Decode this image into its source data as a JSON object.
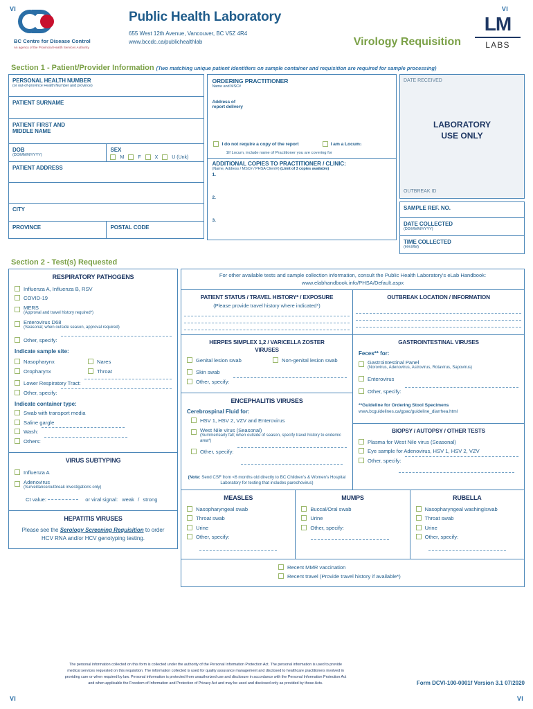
{
  "corner_marks": {
    "top_left": "VI",
    "top_right": "VI",
    "bottom_left": "VI",
    "bottom_right": "VI"
  },
  "header": {
    "cdc_name": "BC Centre for Disease Control",
    "cdc_tagline": "An agency of the Provincial Health Services Authority",
    "lab_title": "Public Health Laboratory",
    "address": "655 West 12th Avenue, Vancouver, BC V5Z 4R4",
    "website": "www.bccdc.ca/publichealthlab",
    "requisition_title": "Virology Requisition",
    "lm_logo_main": "LM",
    "lm_logo_sub": "LABS"
  },
  "section1": {
    "heading": "Section 1 - Patient/Provider Information",
    "heading_note": "(Two matching unique patient identifiers on sample container and requisition are required for sample processing)",
    "patient": {
      "phn_label": "PERSONAL HEALTH NUMBER",
      "phn_sub": "(or out-of-province Health Number and province)",
      "surname_label": "PATIENT SURNAME",
      "firstname_label": "PATIENT FIRST AND",
      "firstname_label2": "MIDDLE NAME",
      "dob_label": "DOB",
      "dob_sub": "(DD/MMM/YYYY)",
      "sex_label": "SEX",
      "sex_options": [
        "M",
        "F",
        "X",
        "U (Unk)"
      ],
      "address_label": "PATIENT ADDRESS",
      "city_label": "CITY",
      "province_label": "PROVINCE",
      "postal_label": "POSTAL CODE"
    },
    "provider": {
      "ordering_label": "ORDERING PRACTITIONER",
      "ordering_sub": "Name and MSC#",
      "address_line1": "Address of",
      "address_line2": "report delivery",
      "no_copy_label": "I do not require a copy of the report",
      "locum_label": "I am a Locum",
      "locum_sup": "1",
      "locum_note": "1If Locum, include name of Practitioner you are covering for",
      "copies_label": "ADDITIONAL COPIES TO PRACTITIONER / CLINIC:",
      "copies_sub": "(Name, Address / MSC# / PHSA Client#)",
      "copies_limit": "(Limit of 3 copies available)",
      "copies_numbers": [
        "1.",
        "2.",
        "3."
      ]
    },
    "lab_use": {
      "date_received": "DATE RECEIVED",
      "title_line1": "LABORATORY",
      "title_line2": "USE ONLY",
      "outbreak_id": "OUTBREAK ID",
      "sample_ref": "SAMPLE REF.  NO.",
      "date_collected": "DATE COLLECTED",
      "date_collected_sub": "(DD/MMM/YYYY)",
      "time_collected": "TIME COLLECTED",
      "time_collected_sub": "(HH:MM)"
    }
  },
  "section2": {
    "heading": "Section 2 - Test(s) Requested",
    "elab_line1": "For other available tests and sample collection information, consult the Public Health Laboratory's eLab Handbook:",
    "elab_handbook": "eLab Handbook",
    "elab_line2": "www.elabhandbook.info/PHSA/Default.aspx",
    "respiratory": {
      "title": "RESPIRATORY PATHOGENS",
      "items": [
        {
          "label": "Influenza A, Influenza B, RSV",
          "sub": ""
        },
        {
          "label": "COVID-19",
          "sub": ""
        },
        {
          "label": "MERS",
          "sub": "(Approval and travel history required*)"
        },
        {
          "label": "Enterovirus D68",
          "sub": "(Seasonal; when outside season, approval required)"
        }
      ],
      "other_label": "Other, specify:",
      "sample_site_head": "Indicate sample site:",
      "sample_sites": [
        "Nasopharynx",
        "Nares",
        "Oropharynx",
        "Throat"
      ],
      "lower_resp_label": "Lower Respiratory Tract:",
      "site_other_label": "Other, specify:",
      "container_head": "Indicate container type:",
      "containers": [
        "Swab with transport media",
        "Saline gargle"
      ],
      "wash_label": "Wash:",
      "others_label": "Others:"
    },
    "subtyping": {
      "title": "VIRUS SUBTYPING",
      "items": [
        {
          "label": "Influenza A",
          "sub": ""
        },
        {
          "label": "Adenovirus",
          "sub": "(Surveillance/outbreak investigations only)"
        }
      ],
      "ct_label": "Ct value:",
      "ct_mid": "or viral signal:",
      "ct_weak": "weak",
      "ct_slash": "/",
      "ct_strong": "strong"
    },
    "hepatitis": {
      "title": "HEPATITIS VIRUSES",
      "text_pre": "Please see the ",
      "link": "Serology Screening Requisition",
      "text_post": " to order",
      "text_line2": "HCV RNA and/or HCV genotyping testing."
    },
    "patient_status": {
      "title": "PATIENT STATUS / TRAVEL HISTORY* / EXPOSURE",
      "sub": "(Please provide travel history where indicated*)"
    },
    "outbreak": {
      "title": "OUTBREAK LOCATION / INFORMATION"
    },
    "herpes": {
      "title_line1": "HERPES SIMPLEX 1,2 / VARICELLA ZOSTER",
      "title_line2": "VIRUSES",
      "items": [
        "Genital lesion swab",
        "Non-genital lesion swab",
        "Skin swab"
      ],
      "other_label": "Other, specify:"
    },
    "gastro": {
      "title": "GASTROINTESTINAL VIRUSES",
      "feces_label": "Feces** for:",
      "items": [
        {
          "label": "Gastrointestinal Panel",
          "sub": "(Norovirus, Adenovirus, Astrovirus, Rotavirus, Sapovirus)"
        },
        {
          "label": "Enterovirus",
          "sub": ""
        }
      ],
      "other_label": "Other, specify:",
      "guideline_title": "**Guideline for Ordering Stool Specimens",
      "guideline_url": "www.bcguidelines.ca/gpac/guideline_diarrhea.html"
    },
    "encephalitis": {
      "title": "ENCEPHALITIS VIRUSES",
      "csf_head": "Cerebrospinal Fluid for:",
      "items": [
        {
          "label": "HSV 1, HSV 2, VZV and Enterovirus",
          "sub": ""
        },
        {
          "label": "West Nile virus (Seasonal)",
          "sub": "(Summer/early fall; when outside of season, specify travel history to endemic area*)"
        }
      ],
      "other_label": "Other, specify:",
      "note_bold": "(Note:",
      "note_text": " Send CSF from <6 months old directly to BC Children's & Women's Hospital Laboratory for testing that includes parechovirus)"
    },
    "biopsy": {
      "title": "BIOPSY / AUTOPSY / OTHER TESTS",
      "items": [
        "Plasma for West Nile virus  (Seasonal)",
        "Eye sample for Adenovirus, HSV 1, HSV 2, VZV"
      ],
      "other_label": "Other, specify:"
    },
    "measles": {
      "title": "MEASLES",
      "items": [
        "Nasopharyngeal swab",
        "Throat swab",
        "Urine"
      ],
      "other_label": "Other, specify:"
    },
    "mumps": {
      "title": "MUMPS",
      "items": [
        "Buccal/Oral swab",
        "Urine"
      ],
      "other_label": "Other, specify:"
    },
    "rubella": {
      "title": "RUBELLA",
      "items": [
        "Nasopharyngeal washing/swab",
        "Throat swab",
        "Urine"
      ],
      "other_label": "Other, specify:"
    },
    "mmr": {
      "vaccination_label": "Recent MMR vaccination",
      "travel_label": "Recent travel (Provide travel history if available*)"
    }
  },
  "footer": {
    "disclaimer_l1": "The personal information collected on this form is collected under the authority of the Personal Information Protection Act. The personal information is used to provide",
    "disclaimer_l2": "medical services requested on this requisition. The information collected is used for quality assurance management and disclosed to healthcare practitioners involved in",
    "disclaimer_l3": "providing care or when required by law. Personal information is protected from unauthorized use and disclosure in accordance with the Personal Information Protection Act",
    "disclaimer_l4": "and when applicable the Freedom of Information and Protection of Privacy Act and may  be used and disclosed only as provided by those Acts.",
    "form_number": "Form DCVI-100-0001f Version 3.1 07/2020"
  }
}
